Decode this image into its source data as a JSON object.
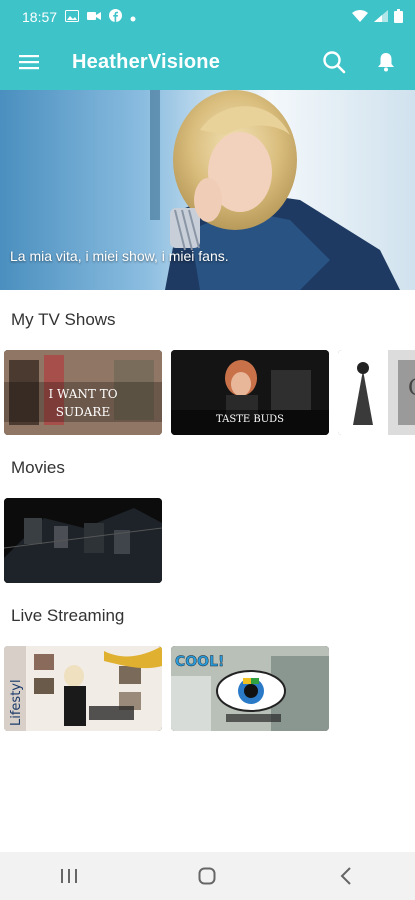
{
  "status_bar": {
    "time": "18:57",
    "left_icons": [
      "image-icon",
      "video-call-icon",
      "facebook-icon",
      "dot-icon"
    ],
    "right_icons": [
      "wifi-icon",
      "signal-icon",
      "battery-icon"
    ]
  },
  "app_bar": {
    "title": "HeatherVisione",
    "background": "#3ec3c9"
  },
  "hero": {
    "tagline": "La mia vita, i miei show, i miei fans."
  },
  "sections": [
    {
      "title": "My TV Shows",
      "items": [
        {
          "caption_line1": "I WANT TO",
          "caption_line2": "SUDARE"
        },
        {
          "caption_line1": "",
          "caption_line2": "TASTE BUDS"
        },
        {
          "caption_line1": "G",
          "caption_line2": ""
        }
      ]
    },
    {
      "title": "Movies",
      "items": [
        {
          "caption_line1": "",
          "caption_line2": ""
        }
      ]
    },
    {
      "title": "Live Streaming",
      "items": [
        {
          "caption_line1": "Lifestyl",
          "caption_line2": ""
        },
        {
          "caption_line1": "COOL!",
          "caption_line2": ""
        }
      ]
    }
  ],
  "nav_bar": {
    "icons": [
      "recent-apps-icon",
      "home-icon",
      "back-icon"
    ]
  }
}
